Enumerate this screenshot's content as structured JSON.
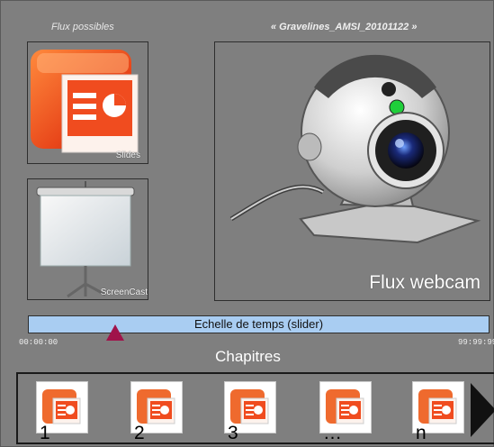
{
  "header": {
    "flux_title": "Flux possibles",
    "session_title": "« Gravelines_AMSI_20101122 »"
  },
  "streams": {
    "slides_label": "Slides",
    "screencast_label": "ScreenCast",
    "webcam_label": "Flux webcam"
  },
  "timeline": {
    "slider_label": "Echelle de temps (slider)",
    "start_time": "00:00:00",
    "end_time": "99:99:99",
    "position_fraction": 0.19
  },
  "chapters": {
    "title": "Chapitres",
    "items": [
      {
        "label": "1"
      },
      {
        "label": "2"
      },
      {
        "label": "3"
      },
      {
        "label": "…"
      },
      {
        "label": "n"
      }
    ]
  },
  "colors": {
    "background": "#7f7f7f",
    "slider": "#a9cdf2",
    "slider_thumb": "#a0134a"
  }
}
